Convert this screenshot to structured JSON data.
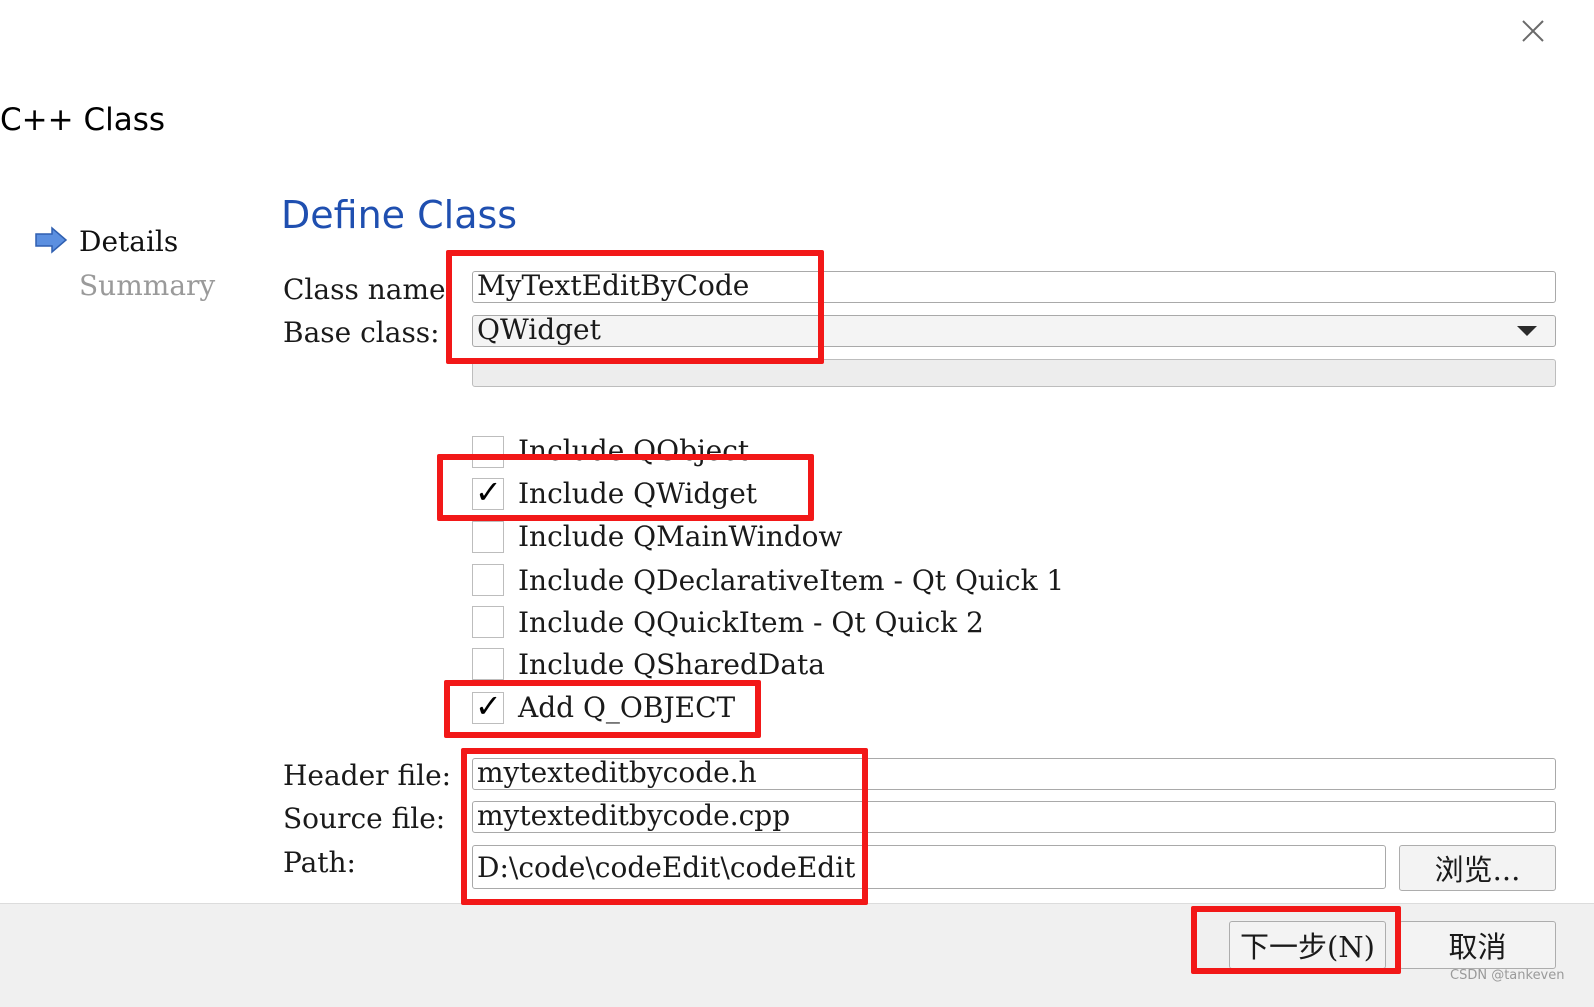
{
  "dialog": {
    "title": "C++ Class",
    "close_icon": "close-icon"
  },
  "nav": {
    "arrow_icon": "arrow-right-icon",
    "items": [
      {
        "label": "Details",
        "active": true
      },
      {
        "label": "Summary",
        "active": false
      }
    ]
  },
  "page": {
    "title": "Define Class",
    "class_name_label": "Class name:",
    "class_name_value": "MyTextEditByCode",
    "base_class_label": "Base class:",
    "base_class_value": "QWidget",
    "type_information_value": "",
    "checkboxes": [
      {
        "label": "Include QObject",
        "checked": false
      },
      {
        "label": "Include QWidget",
        "checked": true
      },
      {
        "label": "Include QMainWindow",
        "checked": false
      },
      {
        "label": "Include QDeclarativeItem - Qt Quick 1",
        "checked": false
      },
      {
        "label": "Include QQuickItem - Qt Quick 2",
        "checked": false
      },
      {
        "label": "Include QSharedData",
        "checked": false
      },
      {
        "label": "Add Q_OBJECT",
        "checked": true
      }
    ],
    "header_file_label": "Header file:",
    "header_file_value": "mytexteditbycode.h",
    "source_file_label": "Source file:",
    "source_file_value": "mytexteditbycode.cpp",
    "path_label": "Path:",
    "path_value": "D:\\code\\codeEdit\\codeEdit",
    "browse_label": "浏览..."
  },
  "footer": {
    "next_label": "下一步(N)",
    "cancel_label": "取消"
  },
  "watermark": "CSDN @tankeven",
  "colors": {
    "accent_title": "#1f4fb0",
    "highlight_red": "#f21818"
  }
}
